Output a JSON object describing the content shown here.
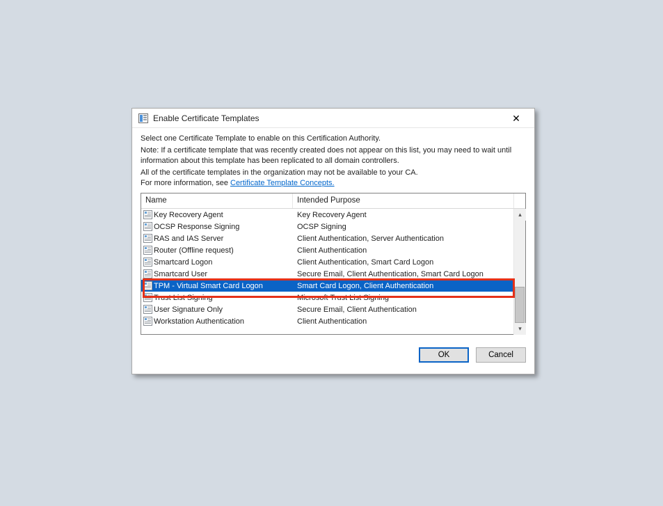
{
  "dialog": {
    "title": "Enable Certificate Templates",
    "description_lines": [
      "Select one Certificate Template to enable on this Certification Authority.",
      "Note: If a certificate template that was recently created does not appear on this list, you may need to wait until information about this template has been replicated to all domain controllers.",
      "All of the certificate templates in the organization may not be available to your CA."
    ],
    "more_info_prefix": "For more information, see ",
    "more_info_link": "Certificate Template Concepts."
  },
  "list": {
    "headers": {
      "name": "Name",
      "purpose": "Intended Purpose"
    },
    "rows": [
      {
        "name": "Key Recovery Agent",
        "purpose": "Key Recovery Agent",
        "selected": false
      },
      {
        "name": "OCSP Response Signing",
        "purpose": "OCSP Signing",
        "selected": false
      },
      {
        "name": "RAS and IAS Server",
        "purpose": "Client Authentication, Server Authentication",
        "selected": false
      },
      {
        "name": "Router (Offline request)",
        "purpose": "Client Authentication",
        "selected": false
      },
      {
        "name": "Smartcard Logon",
        "purpose": "Client Authentication, Smart Card Logon",
        "selected": false
      },
      {
        "name": "Smartcard User",
        "purpose": "Secure Email, Client Authentication, Smart Card Logon",
        "selected": false
      },
      {
        "name": "TPM - Virtual Smart Card Logon",
        "purpose": "Smart Card Logon, Client Authentication",
        "selected": true
      },
      {
        "name": "Trust List Signing",
        "purpose": "Microsoft Trust List Signing",
        "selected": false
      },
      {
        "name": "User Signature Only",
        "purpose": "Secure Email, Client Authentication",
        "selected": false
      },
      {
        "name": "Workstation Authentication",
        "purpose": "Client Authentication",
        "selected": false
      }
    ]
  },
  "buttons": {
    "ok": "OK",
    "cancel": "Cancel"
  }
}
